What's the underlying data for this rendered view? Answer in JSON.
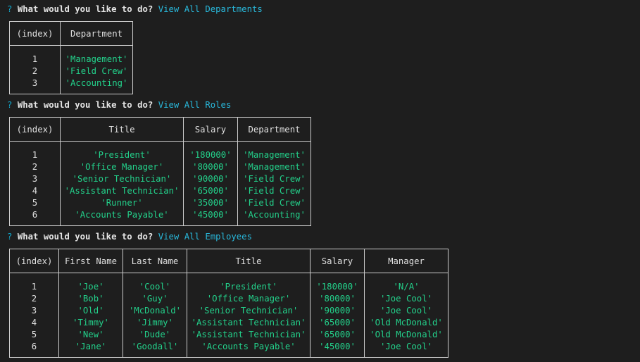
{
  "prompts": [
    {
      "mark": "?",
      "question": "What would you like to do?",
      "answer": "View All Departments"
    },
    {
      "mark": "?",
      "question": "What would you like to do?",
      "answer": "View All Roles"
    },
    {
      "mark": "?",
      "question": "What would you like to do?",
      "answer": "View All Employees"
    }
  ],
  "departments": {
    "headers": [
      "(index)",
      "Department"
    ],
    "rows": [
      [
        "1",
        "'Management'"
      ],
      [
        "2",
        "'Field Crew'"
      ],
      [
        "3",
        "'Accounting'"
      ]
    ]
  },
  "roles": {
    "headers": [
      "(index)",
      "Title",
      "Salary",
      "Department"
    ],
    "rows": [
      [
        "1",
        "'President'",
        "'180000'",
        "'Management'"
      ],
      [
        "2",
        "'Office Manager'",
        "'80000'",
        "'Management'"
      ],
      [
        "3",
        "'Senior Technician'",
        "'90000'",
        "'Field Crew'"
      ],
      [
        "4",
        "'Assistant Technician'",
        "'65000'",
        "'Field Crew'"
      ],
      [
        "5",
        "'Runner'",
        "'35000'",
        "'Field Crew'"
      ],
      [
        "6",
        "'Accounts Payable'",
        "'45000'",
        "'Accounting'"
      ]
    ]
  },
  "employees": {
    "headers": [
      "(index)",
      "First Name",
      "Last Name",
      "Title",
      "Salary",
      "Manager"
    ],
    "rows": [
      [
        "1",
        "'Joe'",
        "'Cool'",
        "'President'",
        "'180000'",
        "'N/A'"
      ],
      [
        "2",
        "'Bob'",
        "'Guy'",
        "'Office Manager'",
        "'80000'",
        "'Joe Cool'"
      ],
      [
        "3",
        "'Old'",
        "'McDonald'",
        "'Senior Technician'",
        "'90000'",
        "'Joe Cool'"
      ],
      [
        "4",
        "'Timmy'",
        "'Jimmy'",
        "'Assistant Technician'",
        "'65000'",
        "'Old McDonald'"
      ],
      [
        "5",
        "'New'",
        "'Dude'",
        "'Assistant Technician'",
        "'65000'",
        "'Old McDonald'"
      ],
      [
        "6",
        "'Jane'",
        "'Goodall'",
        "'Accounts Payable'",
        "'45000'",
        "'Joe Cool'"
      ]
    ]
  },
  "colors": {
    "background": "#1e1e1e",
    "prompt_mark": "#11a8cd",
    "answer": "#29b8db",
    "string_value": "#23d18b",
    "text": "#cccccc"
  }
}
